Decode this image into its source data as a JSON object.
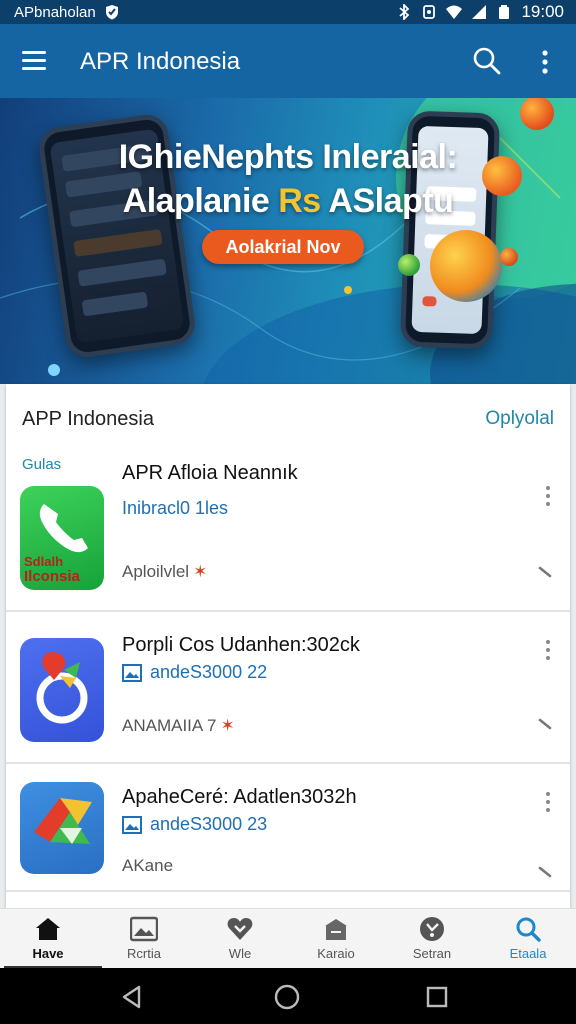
{
  "status_bar": {
    "carrier": "APbnaholan",
    "time": "19:00",
    "icons": [
      "shield-icon",
      "bluetooth-icon",
      "vibrate-icon",
      "wifi-icon",
      "signal-icon",
      "battery-icon"
    ]
  },
  "app_bar": {
    "title": "APR Indonesia",
    "icons": [
      "menu-icon",
      "search-icon",
      "more-vertical-icon"
    ]
  },
  "banner": {
    "headline_1": "IGhieNephts Inleraial:",
    "headline_2_part1": "Alaplanie ",
    "headline_2_accent": "Rs",
    "headline_2_part2": " ASlaptu",
    "cta_label": "Aolakrial Nov",
    "accent_color": "#f4c430",
    "cta_color": "#ea5a1f"
  },
  "section": {
    "title": "APP Indonesia",
    "link": "Oplyolal",
    "category": "Gulas"
  },
  "apps": [
    {
      "name": "APR Afloia Neannık",
      "subtitle": "Inibracl0 1les",
      "meta": "Aploilvlel",
      "mark": "✶",
      "icon": "phone-icon",
      "icon_text_1": "Sdlalh",
      "icon_text_2": "Ilconsia"
    },
    {
      "name": "Porpli Cos Udanhen:302ck",
      "subtitle": "andeS3000 22",
      "meta": "ANAMAIIA 7",
      "mark": "✶",
      "icon": "map-ring-icon"
    },
    {
      "name": "ApaheCeré: Adatlen3032h",
      "subtitle": "andeS3000 23",
      "meta": "AKane",
      "mark": "",
      "icon": "triangle-logo-icon"
    }
  ],
  "bottom_nav": [
    {
      "label": "Have",
      "icon": "home-icon"
    },
    {
      "label": "Rcrtia",
      "icon": "image-icon"
    },
    {
      "label": "Wle",
      "icon": "heart-icon"
    },
    {
      "label": "Karaio",
      "icon": "store-icon"
    },
    {
      "label": "Setran",
      "icon": "settings-dial-icon"
    },
    {
      "label": "Etaala",
      "icon": "search-icon"
    }
  ],
  "colors": {
    "app_bar": "#1565a3",
    "status_bar": "#0d3f6b",
    "link": "#1e88a8"
  }
}
